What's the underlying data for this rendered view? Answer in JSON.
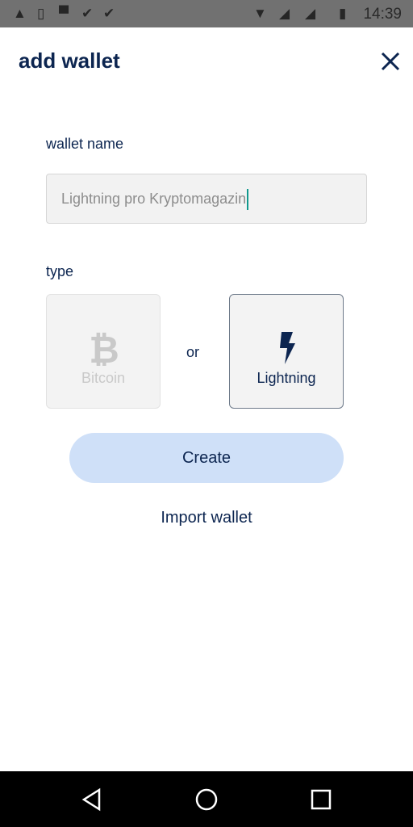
{
  "status_bar": {
    "time": "14:39",
    "icons": [
      "warning-icon",
      "phone-sync-icon",
      "image-icon",
      "check-icon",
      "check-icon",
      "wifi-icon",
      "signal-icon",
      "signal-roaming-icon",
      "battery-icon"
    ]
  },
  "header": {
    "title": "add wallet",
    "close_icon": "close-icon"
  },
  "form": {
    "name_label": "wallet name",
    "name_value": "Lightning pro Kryptomagazin",
    "type_label": "type",
    "options": [
      {
        "label": "Bitcoin",
        "icon": "bitcoin-icon",
        "selected": false
      },
      {
        "label": "Lightning",
        "icon": "lightning-icon",
        "selected": true
      }
    ],
    "or_label": "or",
    "create_label": "Create",
    "import_label": "Import wallet"
  },
  "nav_bar": {
    "icons": [
      "back-icon",
      "home-icon",
      "recents-icon"
    ]
  },
  "colors": {
    "primary": "#0c2550",
    "button": "#cfe0f8",
    "caret": "#11998e"
  }
}
